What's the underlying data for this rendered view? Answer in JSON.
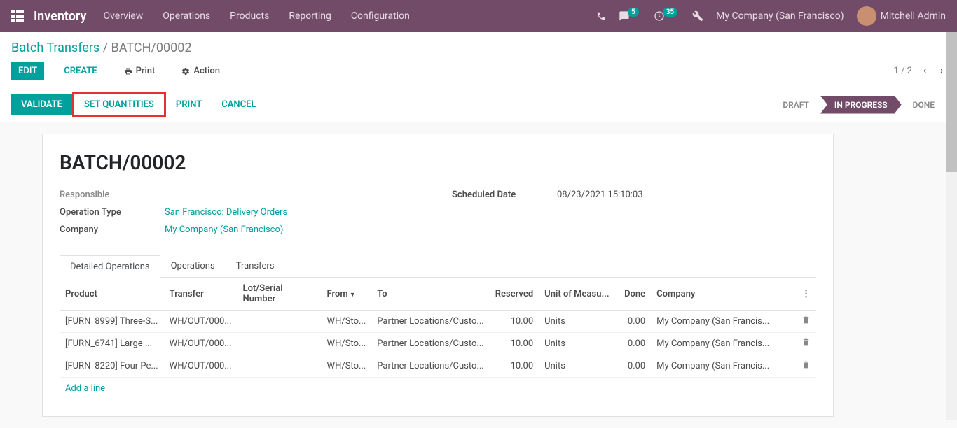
{
  "header": {
    "brand": "Inventory",
    "nav": [
      "Overview",
      "Operations",
      "Products",
      "Reporting",
      "Configuration"
    ],
    "chat_badge": "5",
    "activity_badge": "35",
    "company": "My Company (San Francisco)",
    "user": "Mitchell Admin"
  },
  "breadcrumb": {
    "parent": "Batch Transfers",
    "current": "BATCH/00002"
  },
  "buttons": {
    "edit": "EDIT",
    "create": "CREATE",
    "print": "Print",
    "action": "Action",
    "validate": "VALIDATE",
    "set_quantities": "SET QUANTITIES",
    "print2": "PRINT",
    "cancel": "CANCEL"
  },
  "pager": {
    "text": "1 / 2"
  },
  "status": {
    "draft": "DRAFT",
    "in_progress": "IN PROGRESS",
    "done": "DONE"
  },
  "form": {
    "title": "BATCH/00002",
    "labels": {
      "responsible": "Responsible",
      "operation_type": "Operation Type",
      "company": "Company",
      "scheduled_date": "Scheduled Date"
    },
    "values": {
      "operation_type": "San Francisco: Delivery Orders",
      "company": "My Company (San Francisco)",
      "scheduled_date": "08/23/2021 15:10:03"
    }
  },
  "tabs": {
    "detailed": "Detailed Operations",
    "operations": "Operations",
    "transfers": "Transfers"
  },
  "table": {
    "headers": {
      "product": "Product",
      "transfer": "Transfer",
      "lot": "Lot/Serial Number",
      "from": "From",
      "to": "To",
      "reserved": "Reserved",
      "uom": "Unit of Measu...",
      "done": "Done",
      "company": "Company"
    },
    "rows": [
      {
        "product": "[FURN_8999] Three-S...",
        "transfer": "WH/OUT/000...",
        "from": "WH/Sto...",
        "to": "Partner Locations/Custo...",
        "reserved": "10.00",
        "uom": "Units",
        "done": "0.00",
        "company": "My Company (San Francis..."
      },
      {
        "product": "[FURN_6741] Large ...",
        "transfer": "WH/OUT/000...",
        "from": "WH/Sto...",
        "to": "Partner Locations/Custo...",
        "reserved": "10.00",
        "uom": "Units",
        "done": "0.00",
        "company": "My Company (San Francis..."
      },
      {
        "product": "[FURN_8220] Four Pe...",
        "transfer": "WH/OUT/000...",
        "from": "WH/Sto...",
        "to": "Partner Locations/Custo...",
        "reserved": "10.00",
        "uom": "Units",
        "done": "0.00",
        "company": "My Company (San Francis..."
      }
    ],
    "add_line": "Add a line"
  }
}
